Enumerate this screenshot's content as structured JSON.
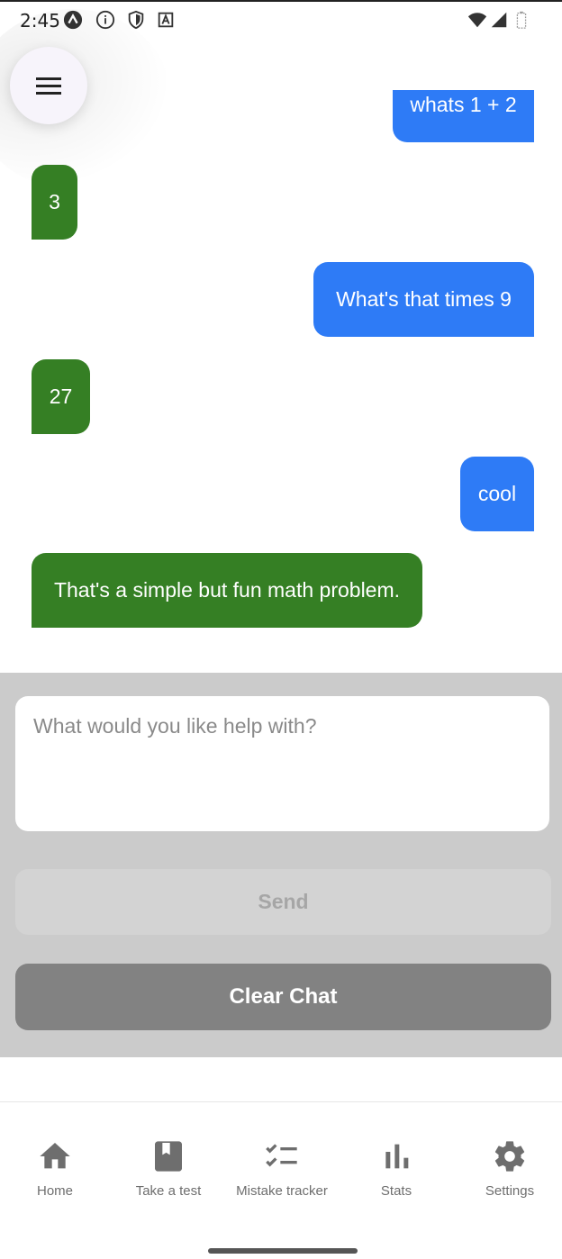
{
  "status_bar": {
    "time": "2:45",
    "left_icons": [
      "navigation-arrow-icon",
      "info-icon",
      "shield-icon",
      "a-box-icon"
    ],
    "right_icons": [
      "wifi-icon",
      "signal-icon",
      "battery-icon"
    ]
  },
  "menu": {
    "icon": "hamburger-menu-icon"
  },
  "messages": [
    {
      "sender": "user",
      "text": "whats 1 + 2"
    },
    {
      "sender": "assistant",
      "text": "3"
    },
    {
      "sender": "user",
      "text": "What's that times 9"
    },
    {
      "sender": "assistant",
      "text": "27"
    },
    {
      "sender": "user",
      "text": "cool"
    },
    {
      "sender": "assistant",
      "text": "That's a simple but fun math problem."
    }
  ],
  "composer": {
    "placeholder": "What would you like help with?",
    "value": "",
    "send_label": "Send",
    "clear_label": "Clear Chat"
  },
  "bottom_nav": {
    "items": [
      {
        "label": "Home",
        "icon": "home-icon"
      },
      {
        "label": "Take a test",
        "icon": "book-icon"
      },
      {
        "label": "Mistake tracker",
        "icon": "checklist-icon"
      },
      {
        "label": "Stats",
        "icon": "bar-chart-icon"
      },
      {
        "label": "Settings",
        "icon": "gear-icon"
      }
    ]
  },
  "colors": {
    "user_bubble": "#2e7bf6",
    "assistant_bubble": "#357f24",
    "panel_background": "#cbcbcb",
    "send_disabled": "#d3d3d3",
    "clear_button": "#828282",
    "nav_icon": "#6e6e6e"
  }
}
